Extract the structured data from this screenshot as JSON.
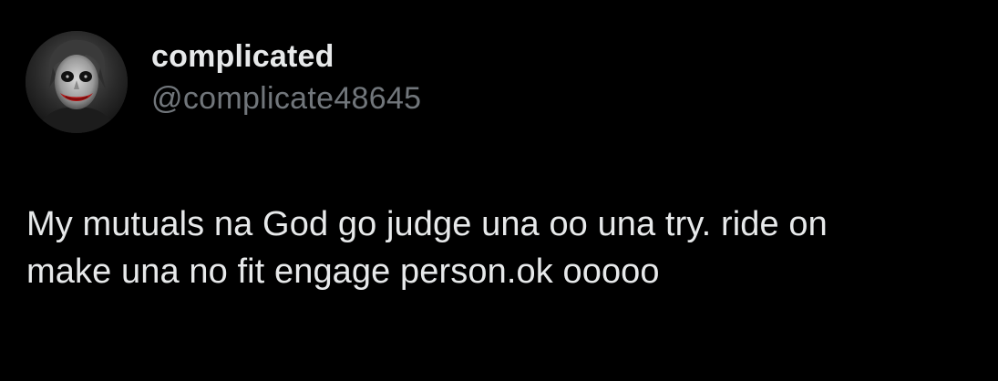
{
  "user": {
    "display_name": "complicated",
    "handle": "@complicate48645",
    "avatar_icon": "joker-avatar"
  },
  "tweet": {
    "text_line1": "My mutuals na God go judge una oo una try. ride on",
    "text_line2": "make una no fit engage person.ok ooooo"
  },
  "colors": {
    "background": "#000000",
    "primary_text": "#e7e9ea",
    "secondary_text": "#71767b"
  }
}
